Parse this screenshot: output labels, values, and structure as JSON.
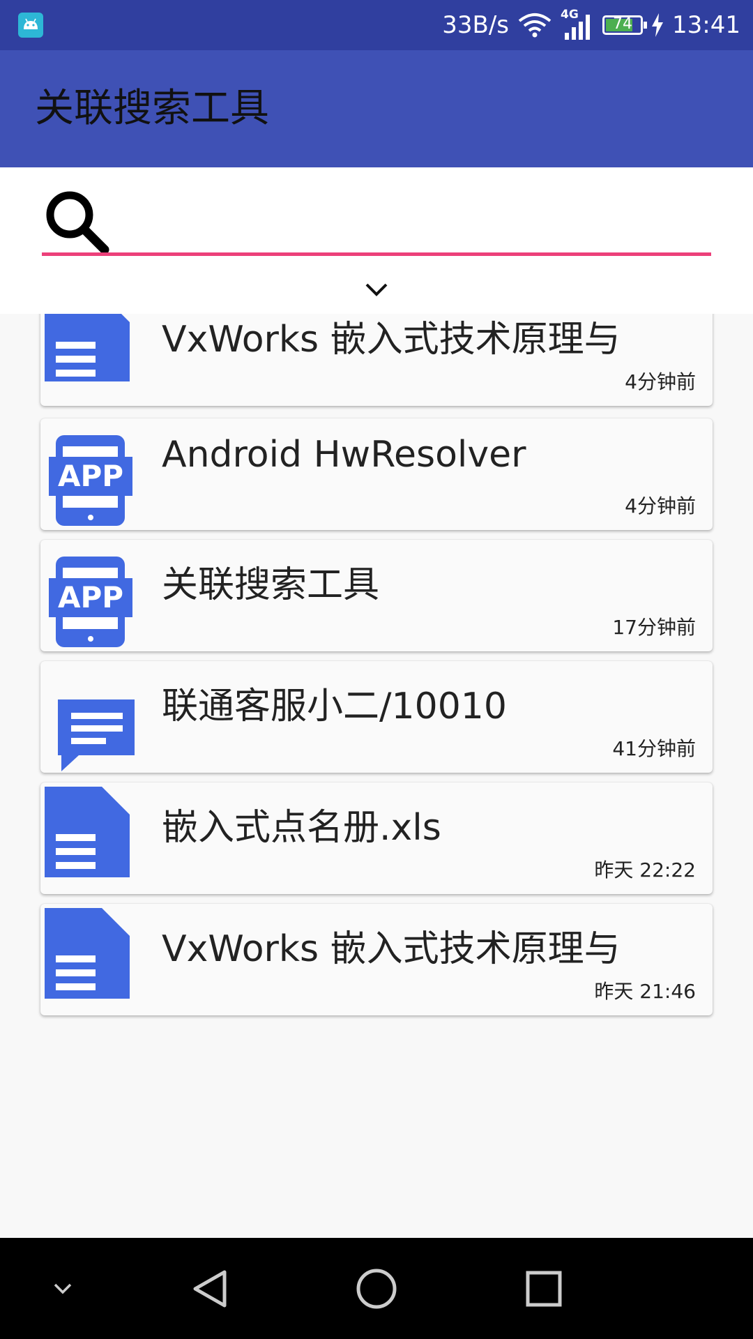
{
  "status_bar": {
    "network_speed": "33B/s",
    "network_type": "4G",
    "battery_level": "74",
    "time": "13:41",
    "colors": {
      "background": "#303f9f"
    }
  },
  "app_bar": {
    "title": "关联搜索工具",
    "colors": {
      "background": "#3f51b5"
    }
  },
  "search": {
    "value": "",
    "placeholder": "",
    "underline_color": "#ec407a"
  },
  "results": [
    {
      "type": "document-icon",
      "title": "VxWorks 嵌入式技术原理与",
      "time": "4分钟前"
    },
    {
      "type": "app-icon",
      "title": "Android HwResolver",
      "time": "4分钟前"
    },
    {
      "type": "app-icon",
      "title": "关联搜索工具",
      "time": "17分钟前"
    },
    {
      "type": "message-icon",
      "title": "联通客服小二/10010",
      "time": "41分钟前"
    },
    {
      "type": "document-icon",
      "title": "嵌入式点名册.xls",
      "time": "昨天 22:22"
    },
    {
      "type": "document-icon",
      "title": "VxWorks 嵌入式技术原理与",
      "time": "昨天 21:46"
    }
  ],
  "icon_color": "#4169e1",
  "nav_bar": {
    "buttons": [
      "chevron-down-icon",
      "back-icon",
      "home-icon",
      "recents-icon"
    ]
  }
}
